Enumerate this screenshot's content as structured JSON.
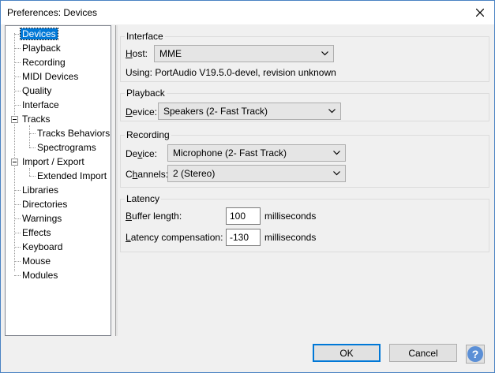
{
  "window": {
    "title": "Preferences: Devices"
  },
  "tree": {
    "items": [
      {
        "label": "Devices"
      },
      {
        "label": "Playback"
      },
      {
        "label": "Recording"
      },
      {
        "label": "MIDI Devices"
      },
      {
        "label": "Quality"
      },
      {
        "label": "Interface"
      },
      {
        "label": "Tracks"
      },
      {
        "label": "Tracks Behaviors"
      },
      {
        "label": "Spectrograms"
      },
      {
        "label": "Import / Export"
      },
      {
        "label": "Extended Import"
      },
      {
        "label": "Libraries"
      },
      {
        "label": "Directories"
      },
      {
        "label": "Warnings"
      },
      {
        "label": "Effects"
      },
      {
        "label": "Keyboard"
      },
      {
        "label": "Mouse"
      },
      {
        "label": "Modules"
      }
    ],
    "selected": "Devices"
  },
  "interface": {
    "title": "Interface",
    "host_label_a": "H",
    "host_label_b": "ost:",
    "host_value": "MME",
    "using_text": "Using: PortAudio V19.5.0-devel, revision unknown"
  },
  "playback": {
    "title": "Playback",
    "device_label_a": "D",
    "device_label_b": "evice:",
    "device_value": "Speakers (2- Fast Track)"
  },
  "recording": {
    "title": "Recording",
    "device_label_a": "De",
    "device_label_u": "v",
    "device_label_b": "ice:",
    "device_value": "Microphone (2- Fast Track)",
    "channels_label_a": "C",
    "channels_label_u": "h",
    "channels_label_b": "annels:",
    "channels_value": "2 (Stereo)"
  },
  "latency": {
    "title": "Latency",
    "buffer_label_a": "B",
    "buffer_label_b": "uffer length:",
    "buffer_value": "100",
    "buffer_unit": "milliseconds",
    "comp_label_a": "L",
    "comp_label_b": "atency compensation:",
    "comp_value": "-130",
    "comp_unit": "milliseconds"
  },
  "buttons": {
    "ok": "OK",
    "cancel": "Cancel",
    "help": "?"
  }
}
